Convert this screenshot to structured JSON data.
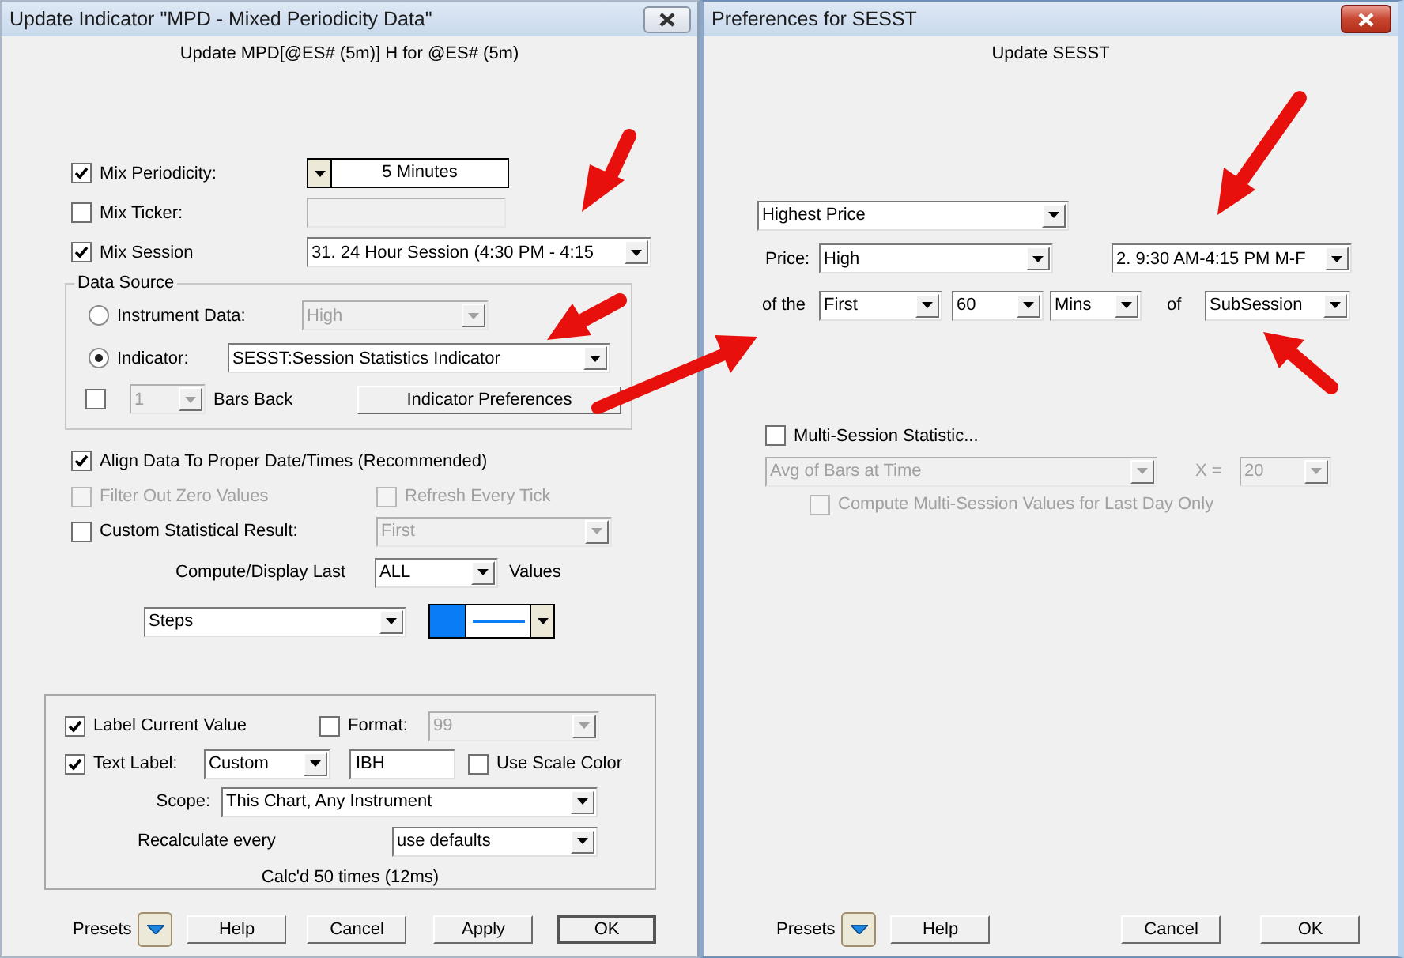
{
  "left_dialog": {
    "title": "Update Indicator \"MPD - Mixed Periodicity Data\"",
    "subtitle": "Update MPD[@ES# (5m)] H for @ES# (5m)",
    "mix_periodicity": {
      "label": "Mix Periodicity:",
      "checked": true,
      "value": "5 Minutes"
    },
    "mix_ticker": {
      "label": "Mix Ticker:",
      "checked": false
    },
    "mix_session": {
      "label": "Mix Session",
      "checked": true,
      "value": "31. 24 Hour Session (4:30 PM - 4:15"
    },
    "data_source": {
      "legend": "Data Source",
      "options": [
        {
          "label": "Instrument Data:",
          "selected": false,
          "value": "High"
        },
        {
          "label": "Indicator:",
          "selected": true,
          "value": "SESST:Session Statistics Indicator"
        }
      ],
      "bars_back": {
        "checked": false,
        "value": "1",
        "label": "Bars Back"
      },
      "preferences_button": "Indicator Preferences"
    },
    "align": {
      "label": "Align Data To Proper Date/Times (Recommended)",
      "checked": true
    },
    "filter_zero": {
      "label": "Filter Out Zero Values",
      "checked": false,
      "disabled": true
    },
    "refresh": {
      "label": "Refresh Every Tick",
      "checked": false,
      "disabled": true
    },
    "custom_result": {
      "label": "Custom Statistical Result:",
      "checked": false,
      "value": "First"
    },
    "compute": {
      "label": "Compute/Display Last",
      "value": "ALL",
      "suffix": "Values"
    },
    "plot_style": {
      "value": "Steps",
      "color": "#0a7cf5"
    },
    "label_current_value": {
      "label": "Label Current Value",
      "checked": true
    },
    "format": {
      "label": "Format:",
      "checked": false,
      "value": "99"
    },
    "text_label": {
      "label": "Text Label:",
      "checked": true,
      "mode": "Custom",
      "value": "IBH"
    },
    "use_scale_color": {
      "label": "Use Scale Color",
      "checked": false
    },
    "scope": {
      "label": "Scope:",
      "value": "This Chart, Any Instrument"
    },
    "recalculate": {
      "label": "Recalculate every",
      "value": "use defaults"
    },
    "calc_status": "Calc'd 50 times (12ms)",
    "presets_label": "Presets",
    "buttons": [
      {
        "label": "Help",
        "default": false
      },
      {
        "label": "Cancel",
        "default": false
      },
      {
        "label": "Apply",
        "default": false
      },
      {
        "label": "OK",
        "default": true
      }
    ]
  },
  "right_dialog": {
    "title": "Preferences for SESST",
    "subtitle": "Update SESST",
    "statistic": "Highest Price",
    "price": {
      "label": "Price:",
      "value": "High"
    },
    "session": "2. 9:30 AM-4:15 PM M-F",
    "range": {
      "label": "of the",
      "position": "First",
      "count": "60",
      "unit": "Mins",
      "of_label": "of",
      "scope": "SubSession"
    },
    "multi_session": {
      "label": "Multi-Session Statistic...",
      "checked": false,
      "method": "Avg of Bars at Time",
      "x_label": "X =",
      "x_value": "20"
    },
    "last_day_only": {
      "label": "Compute Multi-Session Values for Last Day Only",
      "checked": false,
      "disabled": true
    },
    "presets_label": "Presets",
    "buttons": [
      {
        "label": "Help",
        "default": false
      },
      {
        "label": "Cancel",
        "default": false
      },
      {
        "label": "OK",
        "default": false
      }
    ]
  }
}
